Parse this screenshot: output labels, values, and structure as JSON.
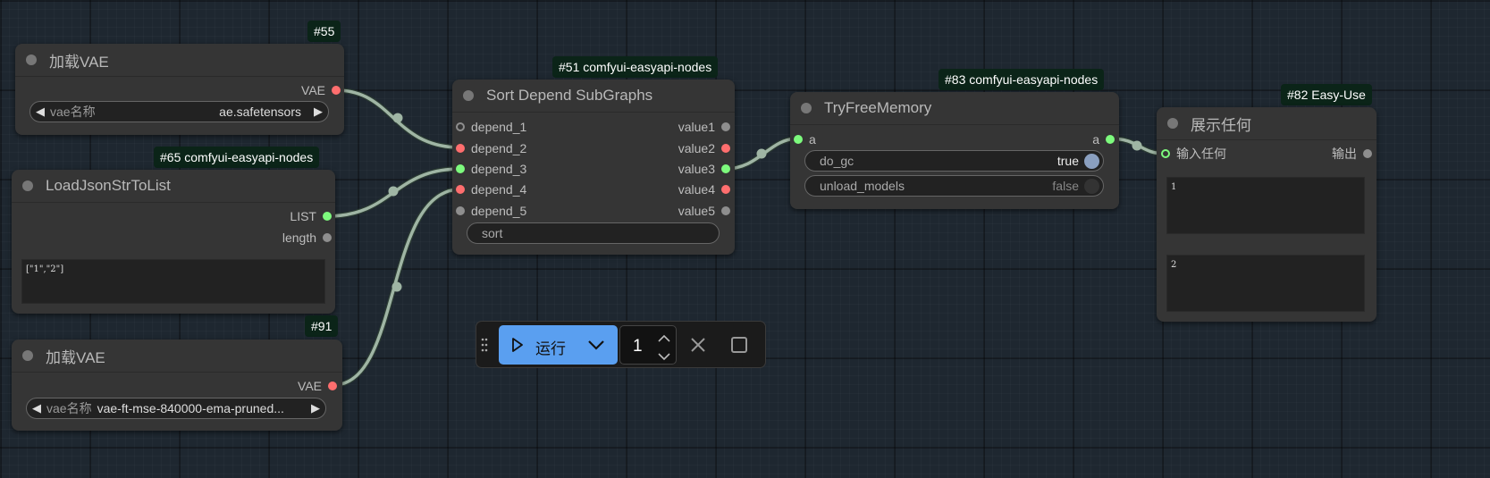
{
  "nodes": {
    "load_vae_top": {
      "badge": "#55",
      "title": "加载VAE",
      "output_vae": "VAE",
      "widget_label": "vae名称",
      "widget_value": "ae.safetensors"
    },
    "load_json": {
      "badge": "#65 comfyui-easyapi-nodes",
      "title": "LoadJsonStrToList",
      "output_list": "LIST",
      "output_length": "length",
      "text": "[\"1\",\"2\"]"
    },
    "load_vae_bottom": {
      "badge": "#91",
      "title": "加载VAE",
      "output_vae": "VAE",
      "widget_label": "vae名称",
      "widget_value": "vae-ft-mse-840000-ema-pruned..."
    },
    "sort_depend": {
      "badge": "#51 comfyui-easyapi-nodes",
      "title": "Sort Depend SubGraphs",
      "inputs": [
        "depend_1",
        "depend_2",
        "depend_3",
        "depend_4",
        "depend_5"
      ],
      "outputs": [
        "value1",
        "value2",
        "value3",
        "value4",
        "value5"
      ],
      "widget_sort": "sort"
    },
    "try_free_memory": {
      "badge": "#83 comfyui-easyapi-nodes",
      "title": "TryFreeMemory",
      "input_a": "a",
      "output_a": "a",
      "do_gc_label": "do_gc",
      "do_gc_value": "true",
      "unload_label": "unload_models",
      "unload_value": "false"
    },
    "show_any": {
      "badge": "#82 Easy-Use",
      "title": "展示任何",
      "input": "输入任何",
      "output": "输出",
      "text_1": "1",
      "text_2": "2"
    }
  },
  "toolbar": {
    "run_label": "运行",
    "run_icon": "play-icon",
    "dropdown_icon": "chevron-down-icon",
    "count": "1",
    "cancel_icon": "close-icon",
    "stop_icon": "stop-icon",
    "drag_icon": "drag-handle-icon"
  },
  "colors": {
    "canvas": "#1e2730",
    "node_bg": "#353535",
    "link": "#9fb5a4",
    "vae_slot": "#ff6e6e",
    "list_slot": "#7dfa7d",
    "any_slot": "#8e8e8e",
    "badge_bg": "#0b2418",
    "run_button": "#5a9ff0"
  }
}
